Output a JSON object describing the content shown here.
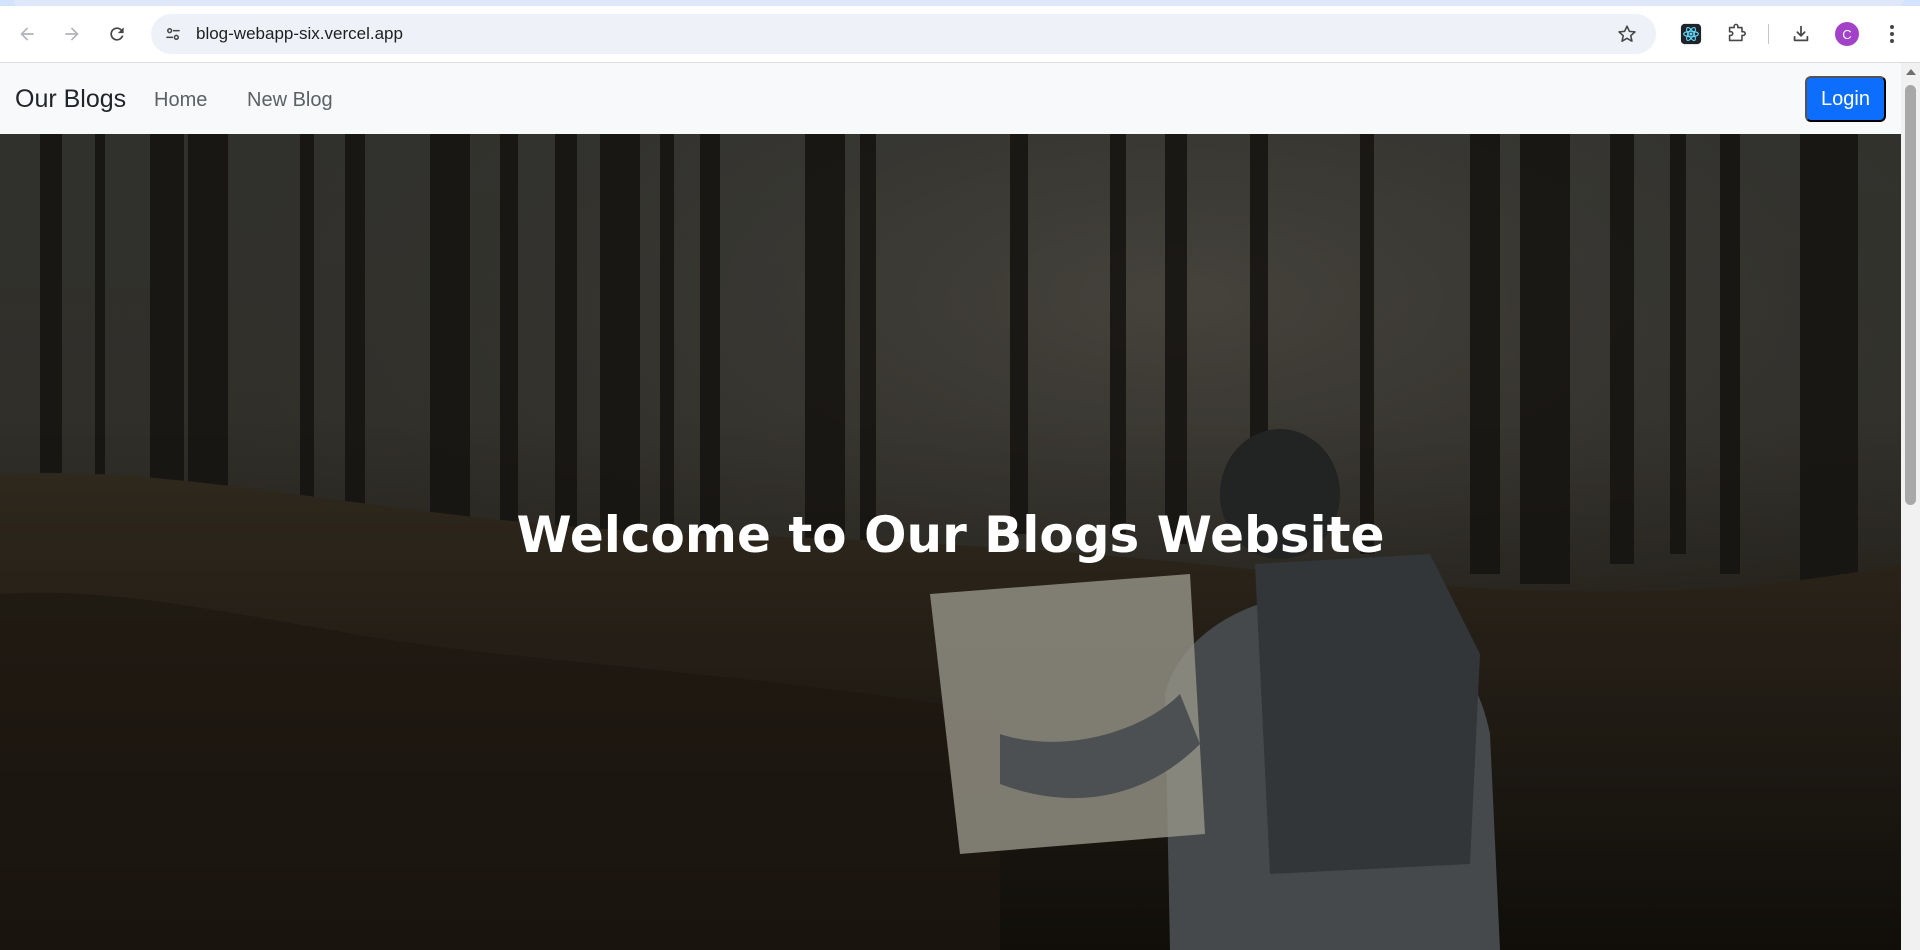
{
  "browser": {
    "url": "blog-webapp-six.vercel.app",
    "icons": {
      "back": "arrow-left-icon",
      "forward": "arrow-right-icon",
      "reload": "reload-icon",
      "site_info": "tune-icon",
      "bookmark": "star-icon",
      "react_devtools": "react-icon",
      "extensions": "puzzle-icon",
      "downloads": "download-icon",
      "menu": "kebab-menu-icon"
    },
    "profile_initial": "C",
    "profile_color": "#a142c9"
  },
  "navbar": {
    "brand": "Our Blogs",
    "links": [
      "Home",
      "New Blog"
    ],
    "login_label": "Login",
    "login_color": "#0d6efd"
  },
  "hero": {
    "title": "Welcome to Our Blogs Website",
    "image_description_color": "#3b3b37"
  }
}
